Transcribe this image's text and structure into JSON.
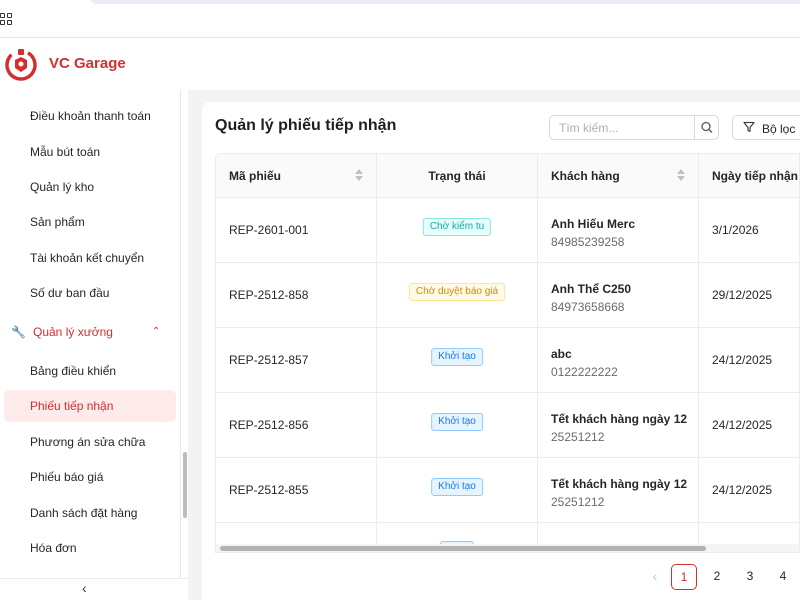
{
  "app": {
    "brand": "VC Garage"
  },
  "sidebar": {
    "items_top": [
      "Điều khoản thanh toán",
      "Mẫu bút toán",
      "Quản lý kho",
      "Sản phẩm",
      "Tài khoản kết chuyển",
      "Số dư ban đầu"
    ],
    "group": {
      "label": "Quản lý xưởng",
      "icon": "wrench-icon",
      "expanded": true
    },
    "items_sub": [
      "Bảng điều khiển",
      "Phiếu tiếp nhận",
      "Phương án sửa chữa",
      "Phiếu báo giá",
      "Danh sách đặt hàng",
      "Hóa đơn"
    ],
    "active_item": "Phiếu tiếp nhận",
    "collapse_icon": "chevron-left-icon"
  },
  "main": {
    "title": "Quản lý phiếu tiếp nhận",
    "search": {
      "placeholder": "Tìm kiếm...",
      "value": ""
    },
    "filter_label": "Bộ lọc",
    "table": {
      "columns": [
        "Mã phiếu",
        "Trạng thái",
        "Khách hàng",
        "Ngày tiếp nhận"
      ],
      "rows": [
        {
          "code": "REP-2601-001",
          "status": "Chờ kiểm tu",
          "status_kind": "teal",
          "customer": "Anh Hiếu Merc",
          "phone": "84985239258",
          "date": "3/1/2026"
        },
        {
          "code": "REP-2512-858",
          "status": "Chờ duyệt báo giá",
          "status_kind": "gold",
          "customer": "Anh Thể C250",
          "phone": "84973658668",
          "date": "29/12/2025"
        },
        {
          "code": "REP-2512-857",
          "status": "Khởi tạo",
          "status_kind": "blue",
          "customer": "abc",
          "phone": "0122222222",
          "date": "24/12/2025"
        },
        {
          "code": "REP-2512-856",
          "status": "Khởi tạo",
          "status_kind": "blue",
          "customer": "Tết khách hàng ngày 12",
          "phone": "25251212",
          "date": "24/12/2025"
        },
        {
          "code": "REP-2512-855",
          "status": "Khởi tạo",
          "status_kind": "blue",
          "customer": "Tết khách hàng ngày 12",
          "phone": "25251212",
          "date": "24/12/2025"
        }
      ]
    },
    "pagination": {
      "pages": [
        "1",
        "2",
        "3",
        "4"
      ],
      "current": "1"
    }
  },
  "colors": {
    "accent": "#d32f2f",
    "active_bg": "#fdeaea",
    "badge_teal": "#13a8a8",
    "badge_gold": "#d48806",
    "badge_blue": "#1677ff"
  }
}
